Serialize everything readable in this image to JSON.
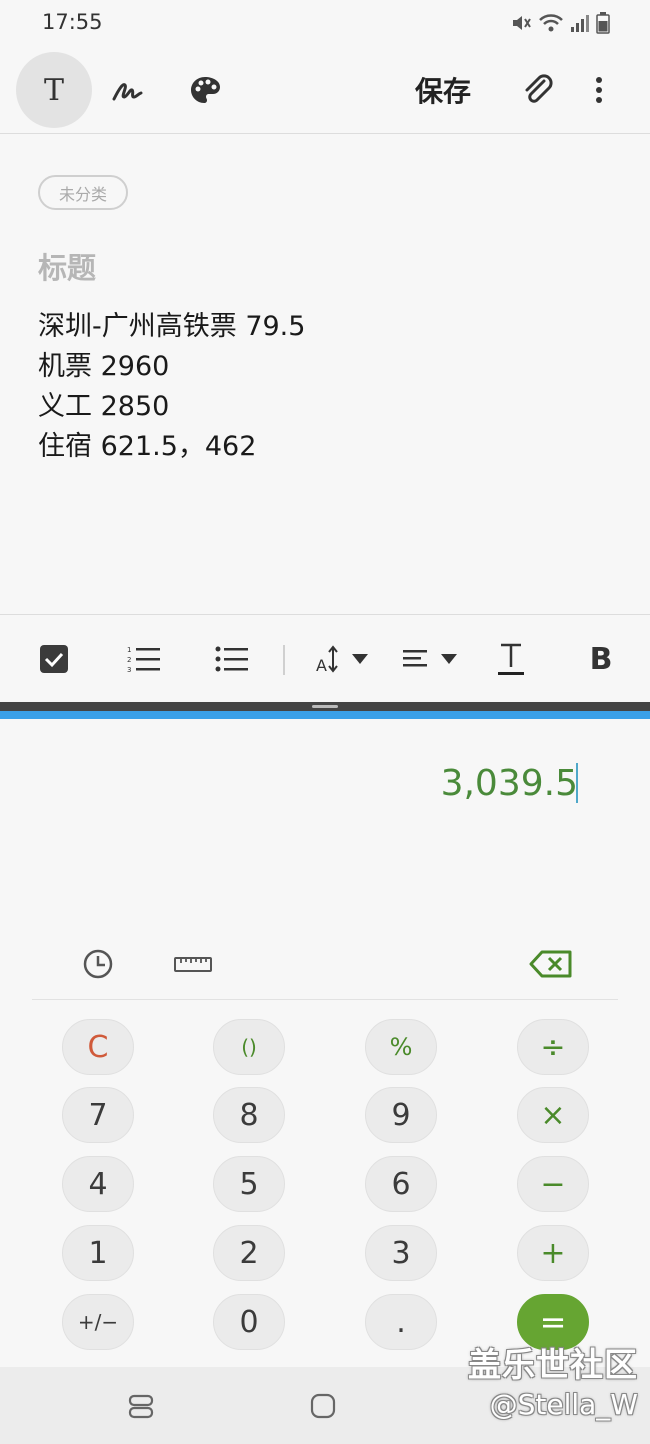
{
  "status_bar": {
    "time": "17:55",
    "icons": [
      "mute-icon",
      "wifi-icon",
      "signal-icon",
      "battery-icon"
    ]
  },
  "notes_toolbar": {
    "text_mode_label": "T",
    "save_label": "保存",
    "icons": [
      "handwriting-icon",
      "palette-icon",
      "attachment-icon",
      "more-icon"
    ]
  },
  "note": {
    "category": "未分类",
    "title_placeholder": "标题",
    "lines": [
      "深圳-广州高铁票 79.5",
      "机票 2960",
      "义工 2850",
      "住宿 621.5，462"
    ]
  },
  "format_toolbar": {
    "items": [
      "checkbox-icon",
      "numbered-list-icon",
      "bullet-list-icon",
      "font-size-icon",
      "align-icon",
      "text-style-icon",
      "bold-icon"
    ]
  },
  "calculator": {
    "display": "3,039.5",
    "tools": [
      "history-icon",
      "unit-converter-icon",
      "backspace-icon"
    ],
    "keys": [
      [
        "C",
        "()",
        "%",
        "÷"
      ],
      [
        "7",
        "8",
        "9",
        "×"
      ],
      [
        "4",
        "5",
        "6",
        "−"
      ],
      [
        "1",
        "2",
        "3",
        "+"
      ],
      [
        "+/−",
        "0",
        ".",
        "="
      ]
    ]
  },
  "nav_bar": {
    "buttons": [
      "recent-apps-button",
      "home-button"
    ]
  },
  "watermark": {
    "line1": "盖乐世社区",
    "line2": "@Stella_W"
  },
  "colors": {
    "accent_green": "#66a532",
    "display_green": "#4a8a3a",
    "clear_red": "#d05a3a",
    "split_blue": "#3aa0e8"
  }
}
